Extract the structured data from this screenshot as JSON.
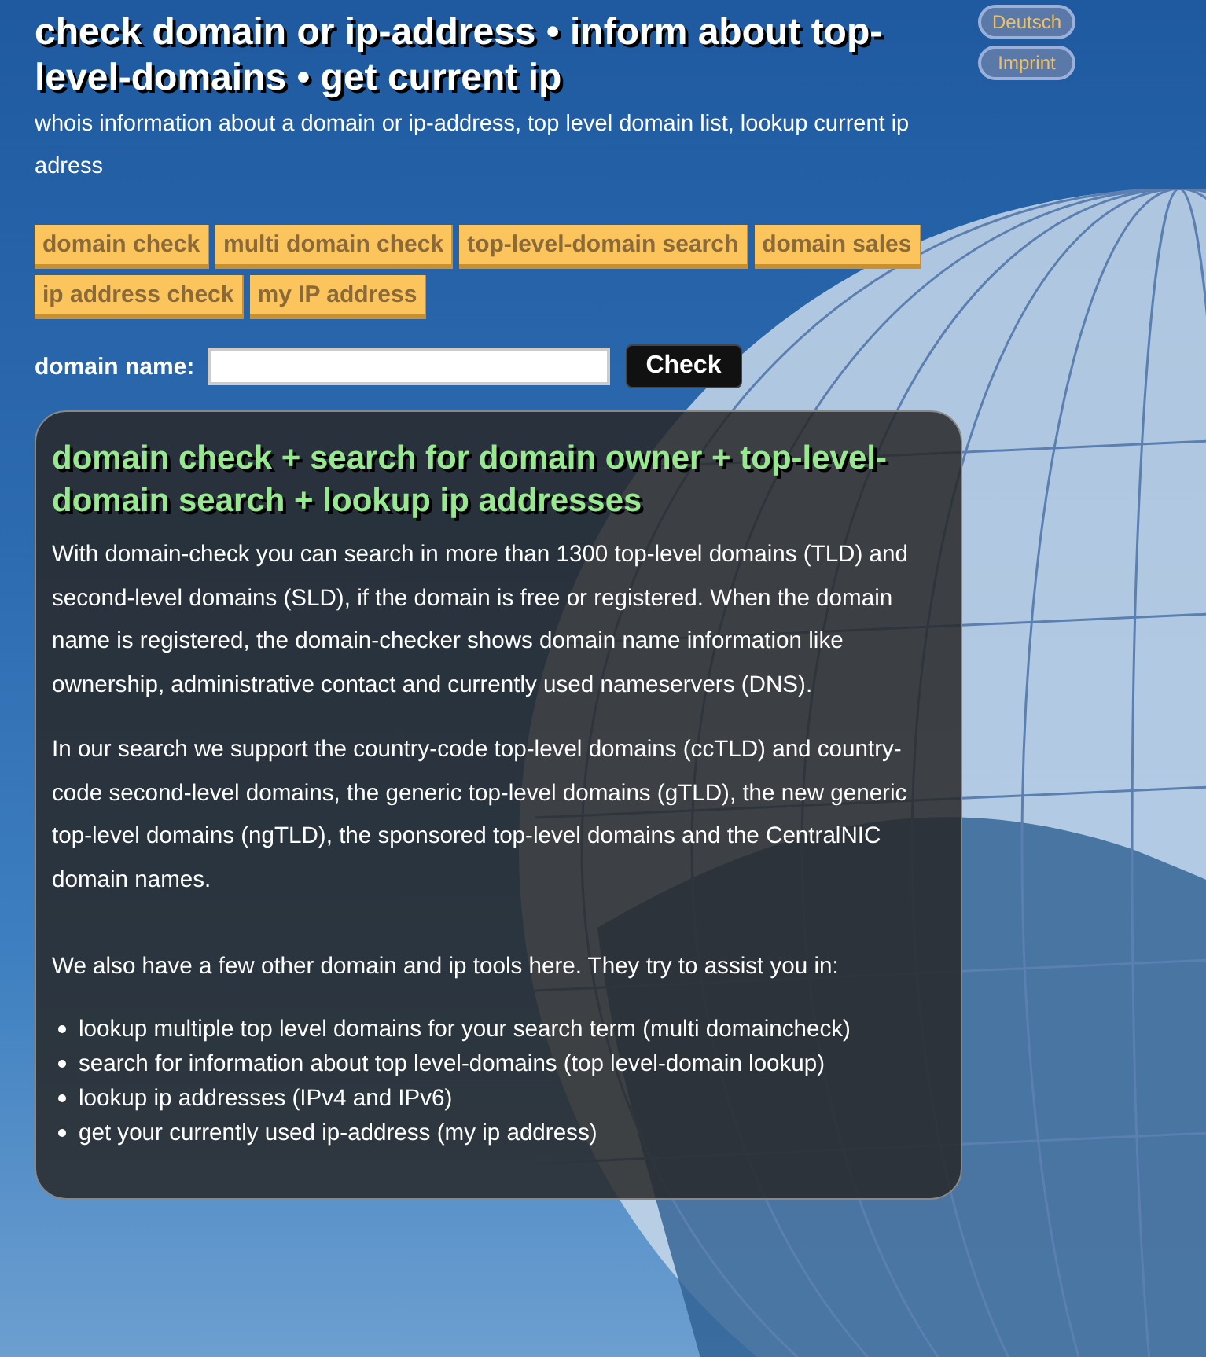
{
  "header": {
    "title": "check domain or ip-address • inform about top-level-domains • get current ip",
    "subtitle": "whois information about a domain or ip-address, top level domain list, lookup current ip adress"
  },
  "language_links": [
    "Deutsch",
    "Imprint"
  ],
  "nav": [
    "domain check",
    "multi domain check",
    "top-level-domain search",
    "domain sales",
    "ip address check",
    "my IP address"
  ],
  "search": {
    "label": "domain name:",
    "button": "Check"
  },
  "panel": {
    "heading": "domain check + search for domain owner + top-level-domain search + lookup ip addresses",
    "paragraphs": [
      "With domain-check you can search in more than 1300 top-level domains (TLD) and second-level domains (SLD), if the domain is free or registered. When the domain name is registered, the domain-checker shows domain name information like ownership, administrative contact and currently used nameservers (DNS).",
      "In our search we support the country-code top-level domains (ccTLD) and country-code second-level domains, the generic top-level domains (gTLD), the new generic top-level domains (ngTLD), the sponsored top-level domains and the CentralNIC domain names.",
      "We also have a few other domain and ip tools here. They try to assist you in:"
    ],
    "list": [
      "lookup multiple top level domains for your search term (multi domaincheck)",
      "search for information about top level-domains (top level-domain lookup)",
      "lookup ip addresses (IPv4 and IPv6)",
      "get your currently used ip-address (my ip address)"
    ]
  }
}
